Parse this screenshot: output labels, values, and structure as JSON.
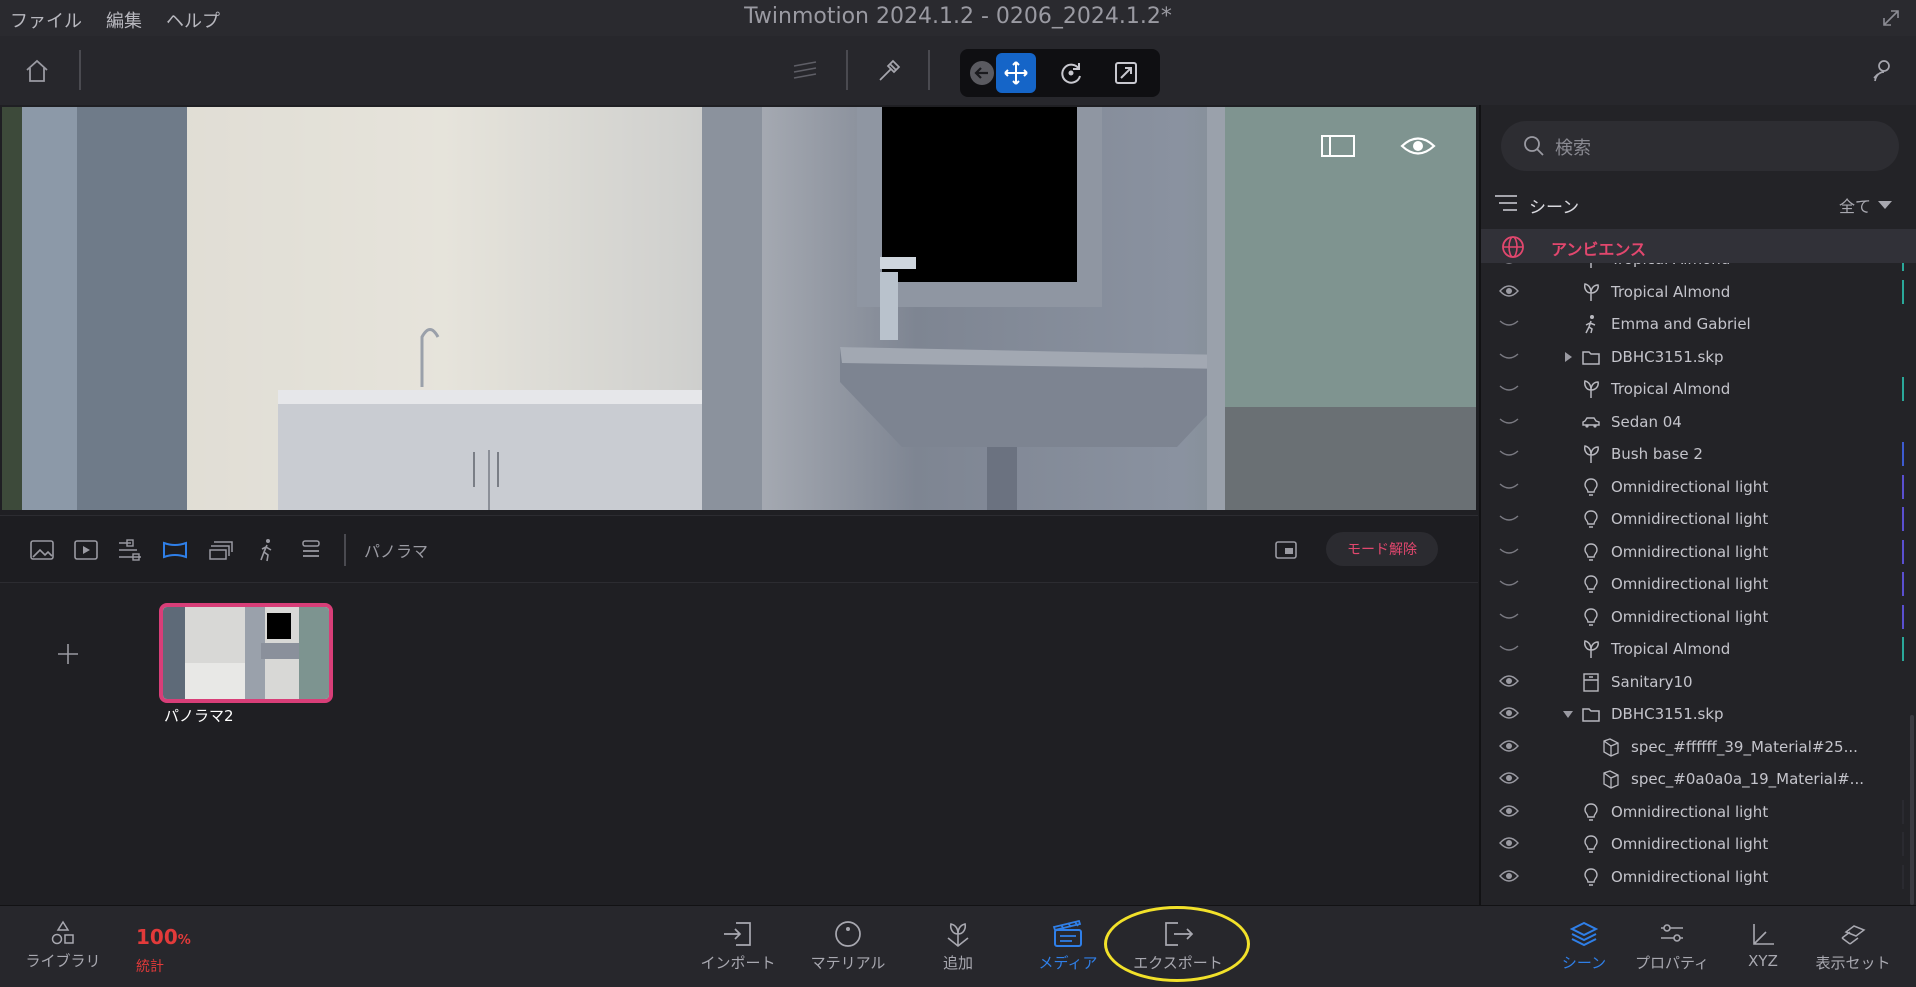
{
  "menu": {
    "file": "ファイル",
    "edit": "編集",
    "help": "ヘルプ"
  },
  "window_title": "Twinmotion 2024.1.2 - 0206_2024.1.2*",
  "media_bar": {
    "mode_label": "パノラマ",
    "exit_mode": "モード解除"
  },
  "media_items": [
    {
      "label": "パノラマ2"
    }
  ],
  "scene_panel": {
    "search_placeholder": "検索",
    "header": "シーン",
    "filter": "全て",
    "ambience": "アンビエンス",
    "rows": [
      {
        "label": "Tropical Almond",
        "icon": "plant-icon",
        "visible": true,
        "indent": 1,
        "bar": "#2aa89a"
      },
      {
        "label": "Tropical Almond",
        "icon": "plant-icon",
        "visible": true,
        "indent": 1,
        "bar": "#2aa89a"
      },
      {
        "label": "Emma and Gabriel",
        "icon": "person-icon",
        "visible": false,
        "indent": 1,
        "bar": ""
      },
      {
        "label": "DBHC3151.skp",
        "icon": "folder-icon",
        "visible": false,
        "indent": 1,
        "expander": "collapsed",
        "bar": ""
      },
      {
        "label": "Tropical Almond",
        "icon": "plant-icon",
        "visible": false,
        "indent": 1,
        "bar": "#2aa89a"
      },
      {
        "label": "Sedan 04",
        "icon": "car-icon",
        "visible": false,
        "indent": 1,
        "bar": ""
      },
      {
        "label": "Bush base 2",
        "icon": "plant-icon",
        "visible": false,
        "indent": 1,
        "bar": "#3d5bd0"
      },
      {
        "label": "Omnidirectional light",
        "icon": "bulb-icon",
        "visible": false,
        "indent": 1,
        "bar": "#5a4fd0"
      },
      {
        "label": "Omnidirectional light",
        "icon": "bulb-icon",
        "visible": false,
        "indent": 1,
        "bar": "#5a4fd0"
      },
      {
        "label": "Omnidirectional light",
        "icon": "bulb-icon",
        "visible": false,
        "indent": 1,
        "bar": "#5a4fd0"
      },
      {
        "label": "Omnidirectional light",
        "icon": "bulb-icon",
        "visible": false,
        "indent": 1,
        "bar": "#5a4fd0"
      },
      {
        "label": "Omnidirectional light",
        "icon": "bulb-icon",
        "visible": false,
        "indent": 1,
        "bar": "#5a4fd0"
      },
      {
        "label": "Tropical Almond",
        "icon": "plant-icon",
        "visible": false,
        "indent": 1,
        "bar": "#2aa89a"
      },
      {
        "label": "Sanitary10",
        "icon": "box-icon",
        "visible": true,
        "indent": 1,
        "bar": ""
      },
      {
        "label": "DBHC3151.skp",
        "icon": "folder-icon",
        "visible": true,
        "indent": 1,
        "expander": "expanded",
        "bar": ""
      },
      {
        "label": "spec_#ffffff_39_Material#25...",
        "icon": "mesh-icon",
        "visible": true,
        "indent": 2,
        "bar": ""
      },
      {
        "label": "spec_#0a0a0a_19_Material#...",
        "icon": "mesh-icon",
        "visible": true,
        "indent": 2,
        "bar": ""
      },
      {
        "label": "Omnidirectional light",
        "icon": "bulb-icon",
        "visible": true,
        "indent": 1,
        "bar": "#2a2a30"
      },
      {
        "label": "Omnidirectional light",
        "icon": "bulb-icon",
        "visible": true,
        "indent": 1,
        "bar": "#2a2a30"
      },
      {
        "label": "Omnidirectional light",
        "icon": "bulb-icon",
        "visible": true,
        "indent": 1,
        "bar": "#2a2a30"
      }
    ]
  },
  "bottom_bar": {
    "library": "ライブラリ",
    "stats_value": "100",
    "stats_unit": "%",
    "stats_label": "統計",
    "import": "インポート",
    "material": "マテリアル",
    "add": "追加",
    "media": "メディア",
    "export": "エクスポート",
    "scene": "シーン",
    "properties": "プロパティ",
    "xyz": "XYZ",
    "display_set": "表示セット"
  },
  "colors": {
    "accent_blue": "#2f7fe8",
    "accent_pink": "#e2476e",
    "highlight_circle": "#f2e12a"
  }
}
